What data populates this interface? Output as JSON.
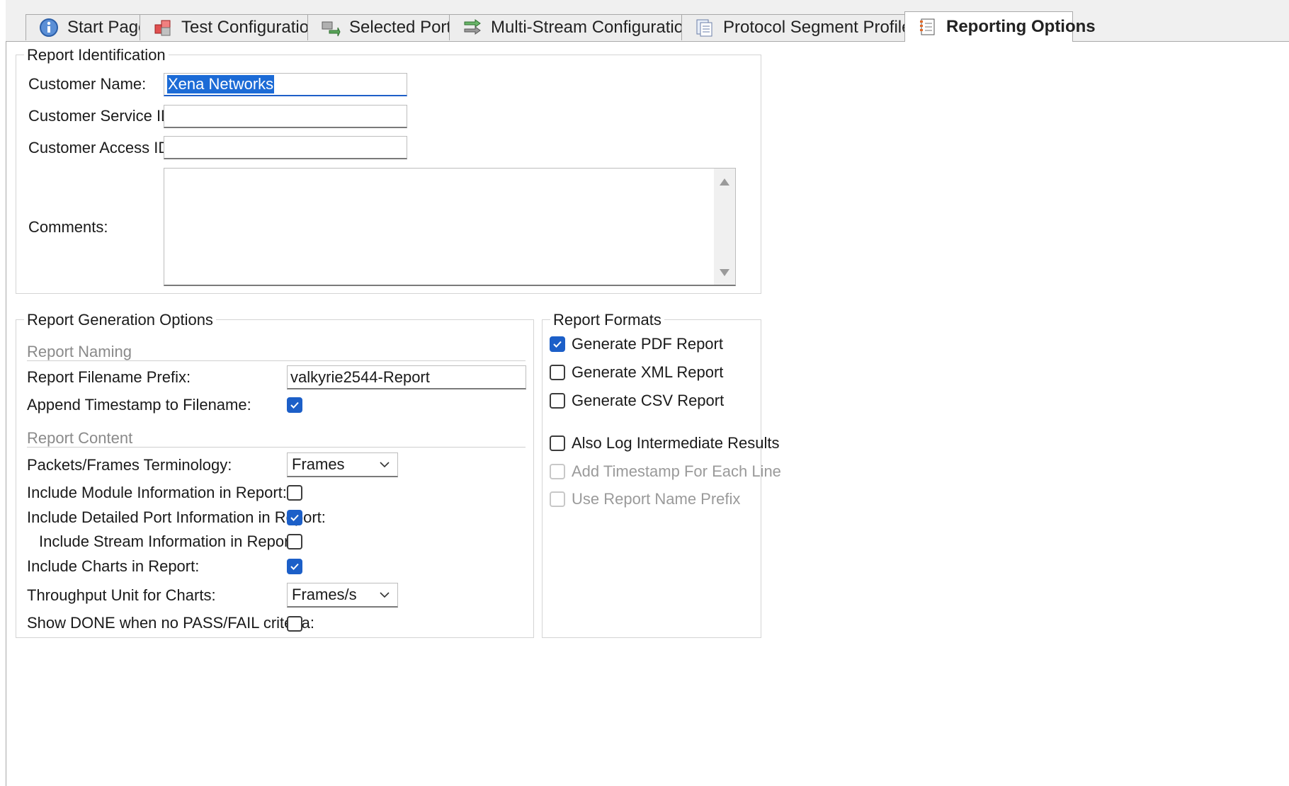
{
  "tabs": [
    {
      "label": "Start Page",
      "icon": "info-icon",
      "active": false
    },
    {
      "label": "Test Configuration",
      "icon": "cubes-icon",
      "active": false
    },
    {
      "label": "Selected Ports",
      "icon": "ports-icon",
      "active": false
    },
    {
      "label": "Multi-Stream Configuration",
      "icon": "streams-icon",
      "active": false
    },
    {
      "label": "Protocol Segment Profiles",
      "icon": "pages-icon",
      "active": false
    },
    {
      "label": "Reporting Options",
      "icon": "report-icon",
      "active": true
    }
  ],
  "identification": {
    "title": "Report Identification",
    "customer_name_label": "Customer Name:",
    "customer_name_value": "Xena Networks",
    "service_id_label": "Customer Service ID:",
    "service_id_value": "",
    "access_id_label": "Customer Access ID:",
    "access_id_value": "",
    "comments_label": "Comments:",
    "comments_value": ""
  },
  "generation": {
    "title": "Report Generation Options",
    "naming_section": "Report Naming",
    "prefix_label": "Report Filename Prefix:",
    "prefix_value": "valkyrie2544-Report",
    "append_ts_label": "Append Timestamp to Filename:",
    "append_ts_checked": true,
    "content_section": "Report Content",
    "terminology_label": "Packets/Frames Terminology:",
    "terminology_value": "Frames",
    "module_info_label": "Include Module Information in Report:",
    "module_info_checked": false,
    "port_info_label": "Include Detailed Port Information in Report:",
    "port_info_checked": true,
    "stream_info_label": "Include Stream Information in Report:",
    "stream_info_checked": false,
    "charts_label": "Include Charts in Report:",
    "charts_checked": true,
    "throughput_unit_label": "Throughput Unit for Charts:",
    "throughput_unit_value": "Frames/s",
    "show_done_label": "Show DONE when no PASS/FAIL criteria:",
    "show_done_checked": false
  },
  "formats": {
    "title": "Report Formats",
    "pdf_label": "Generate PDF Report",
    "pdf_checked": true,
    "xml_label": "Generate XML Report",
    "xml_checked": false,
    "csv_label": "Generate CSV Report",
    "csv_checked": false,
    "log_label": "Also Log Intermediate Results",
    "log_checked": false,
    "timestamp_line_label": "Add Timestamp For Each Line",
    "timestamp_line_checked": false,
    "timestamp_line_enabled": false,
    "name_prefix_label": "Use Report Name Prefix",
    "name_prefix_checked": false,
    "name_prefix_enabled": false
  },
  "colors": {
    "accent": "#1c5fc8",
    "selection": "#1c6bd6",
    "disabled_text": "#9a9a9a"
  }
}
